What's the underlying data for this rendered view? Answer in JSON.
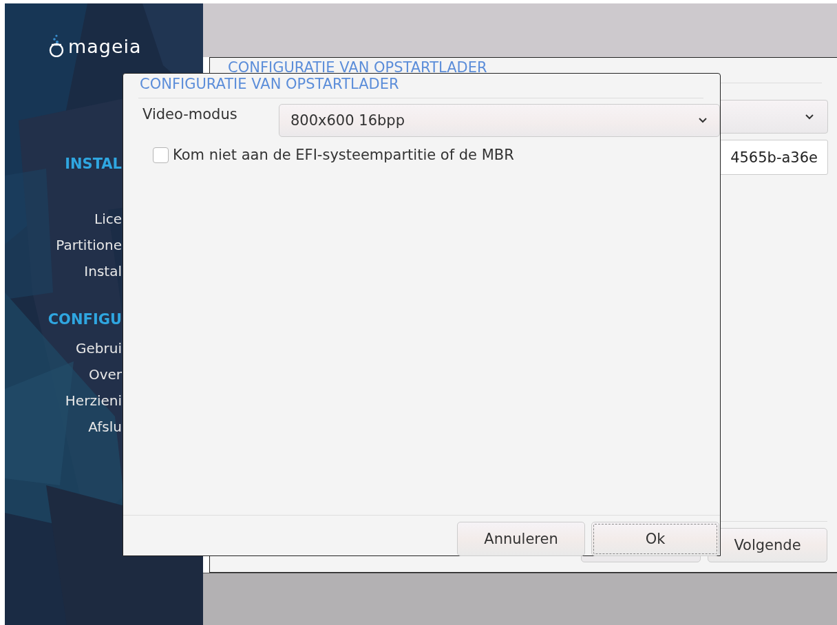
{
  "sidebar": {
    "logo": "mageia",
    "sections": [
      {
        "title": "INSTAL",
        "items": [
          "Lice",
          "Partitione",
          "Instal"
        ]
      },
      {
        "title": "CONFIGU",
        "items": [
          "Gebrui",
          "Over",
          "Herzieni",
          "Afslu"
        ]
      }
    ]
  },
  "background_window": {
    "title": "CONFIGURATIE VAN OPSTARTLADER",
    "field": {
      "value": "4565b-a36e"
    },
    "buttons": [
      {
        "label": "Volgende"
      }
    ]
  },
  "dialog": {
    "title": "CONFIGURATIE VAN OPSTARTLADER",
    "video_mode": {
      "label": "Video-modus",
      "value": "800x600 16bpp"
    },
    "checkbox": {
      "label": "Kom niet aan de EFI-systeempartitie of de MBR",
      "checked": false
    },
    "buttons": [
      {
        "label": "Annuleren",
        "focused": false
      },
      {
        "label": "Ok",
        "focused": true
      }
    ]
  }
}
